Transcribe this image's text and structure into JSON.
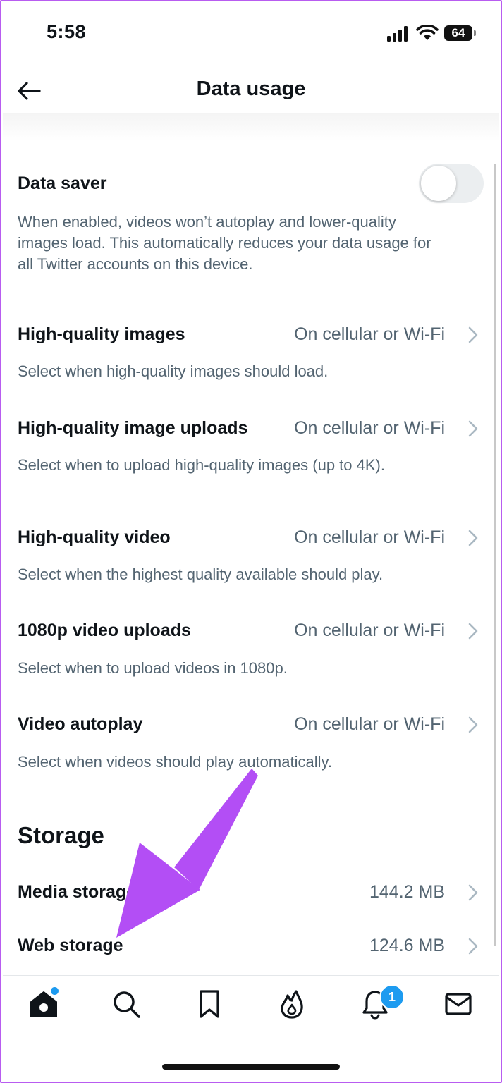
{
  "status_bar": {
    "time": "5:58",
    "battery": "64"
  },
  "header": {
    "title": "Data usage"
  },
  "data_saver": {
    "title": "Data saver",
    "enabled": false,
    "description": [
      "When enabled, videos won’t autoplay and lower-quality",
      "images load. This automatically reduces your data usage for",
      "all Twitter accounts on this device."
    ]
  },
  "settings": [
    {
      "title": "High-quality images",
      "value": "On cellular or Wi-Fi",
      "description": "Select when high-quality images should load."
    },
    {
      "title": "High-quality image uploads",
      "value": "On cellular or Wi-Fi",
      "description": "Select when to upload high-quality images (up to 4K)."
    },
    {
      "title": "High-quality video",
      "value": "On cellular or Wi-Fi",
      "description": "Select when the highest quality available should play."
    },
    {
      "title": "1080p video uploads",
      "value": "On cellular or Wi-Fi",
      "description": "Select when to upload videos in 1080p."
    },
    {
      "title": "Video autoplay",
      "value": "On cellular or Wi-Fi",
      "description": "Select when videos should play automatically."
    }
  ],
  "storage": {
    "title": "Storage",
    "items": [
      {
        "title": "Media storage",
        "value": "144.2 MB"
      },
      {
        "title": "Web storage",
        "value": "124.6 MB"
      }
    ]
  },
  "tabbar": {
    "notifications_count": "1"
  },
  "colors": {
    "accent": "#1d9bf0",
    "annotation_arrow": "#b34ef5",
    "secondary_text": "#536471"
  },
  "icons": [
    "back-arrow-icon",
    "chevron-right-icon",
    "home-icon",
    "search-icon",
    "bookmark-icon",
    "flame-icon",
    "bell-icon",
    "mail-icon"
  ]
}
